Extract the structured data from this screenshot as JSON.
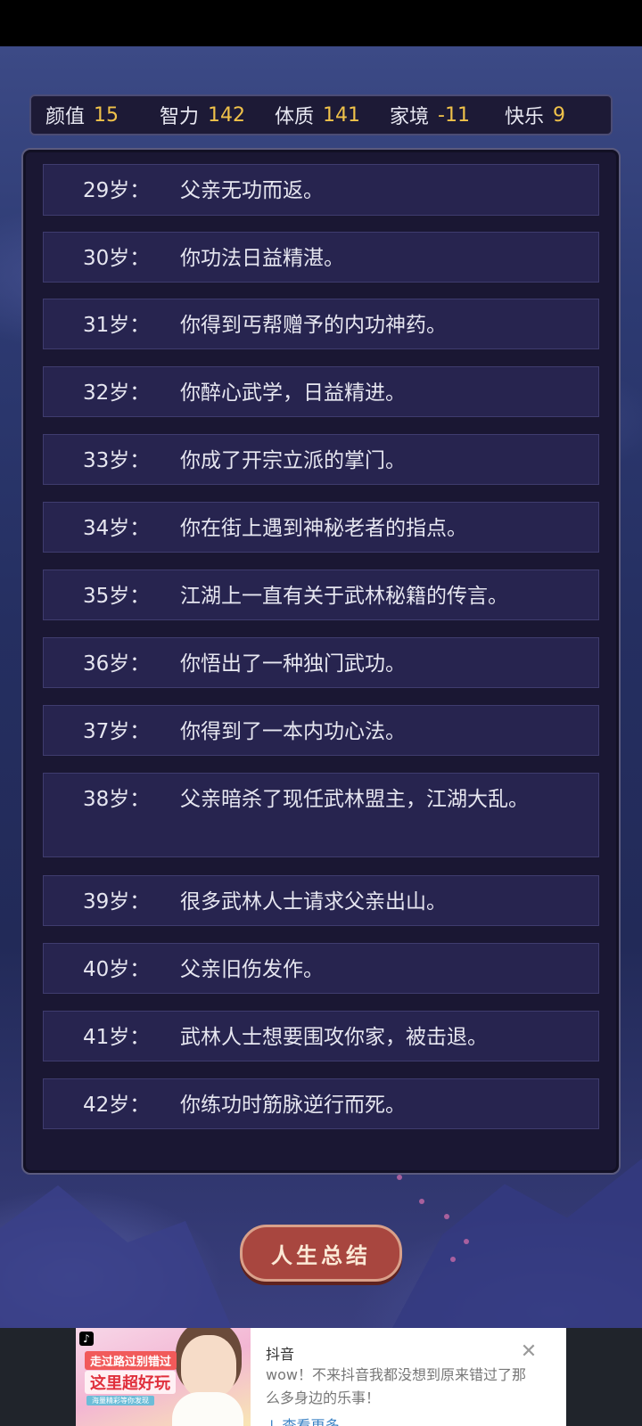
{
  "stats": [
    {
      "label": "颜值",
      "value": "15"
    },
    {
      "label": "智力",
      "value": "142"
    },
    {
      "label": "体质",
      "value": "141"
    },
    {
      "label": "家境",
      "value": "-11"
    },
    {
      "label": "快乐",
      "value": "9"
    }
  ],
  "events": [
    {
      "age": "29岁：",
      "text": "父亲无功而返。"
    },
    {
      "age": "30岁：",
      "text": "你功法日益精湛。"
    },
    {
      "age": "31岁：",
      "text": "你得到丐帮赠予的内功神药。"
    },
    {
      "age": "32岁：",
      "text": "你醉心武学，日益精进。"
    },
    {
      "age": "33岁：",
      "text": "你成了开宗立派的掌门。"
    },
    {
      "age": "34岁：",
      "text": "你在街上遇到神秘老者的指点。"
    },
    {
      "age": "35岁：",
      "text": "江湖上一直有关于武林秘籍的传言。"
    },
    {
      "age": "36岁：",
      "text": "你悟出了一种独门武功。"
    },
    {
      "age": "37岁：",
      "text": "你得到了一本内功心法。"
    },
    {
      "age": "38岁：",
      "text": "父亲暗杀了现任武林盟主，江湖大乱。"
    },
    {
      "age": "39岁：",
      "text": "很多武林人士请求父亲出山。"
    },
    {
      "age": "40岁：",
      "text": "父亲旧伤发作。"
    },
    {
      "age": "41岁：",
      "text": "武林人士想要围攻你家，被击退。"
    },
    {
      "age": "42岁：",
      "text": "你练功时筋脉逆行而死。"
    }
  ],
  "summary_button": "人生总结",
  "ad": {
    "title": "抖音",
    "description": "wow！不来抖音我都没想到原来错过了那么多身边的乐事！",
    "more": "↓ 查看更多",
    "slogan_1": "走过路过别错过",
    "slogan_2": "这里超好玩",
    "slogan_3": "海量精彩等你发现",
    "close_icon": "close-icon",
    "logo_icon": "tiktok-logo-icon"
  }
}
